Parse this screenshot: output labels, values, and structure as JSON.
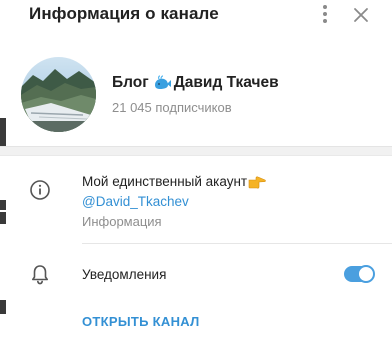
{
  "header": {
    "title": "Информация о канале",
    "menu_icon": "more-vertical-icon",
    "close_icon": "close-icon"
  },
  "profile": {
    "name_prefix": "Блог",
    "name_emoji": "whale-icon",
    "name_suffix": "Давид Ткачев",
    "subscribers": "21 045 подписчиков"
  },
  "about": {
    "icon": "info-icon",
    "text": "Мой единственный акаунт",
    "text_emoji": "pointing-hand-icon",
    "link": "@David_Tkachev",
    "caption": "Информация"
  },
  "notifications": {
    "icon": "bell-icon",
    "label": "Уведомления",
    "enabled": true
  },
  "actions": {
    "open_channel": "ОТКРЫТЬ КАНАЛ"
  },
  "colors": {
    "accent": "#3390d4",
    "toggle": "#4a9fdf",
    "text": "#222222",
    "muted": "#8e8e8e"
  }
}
